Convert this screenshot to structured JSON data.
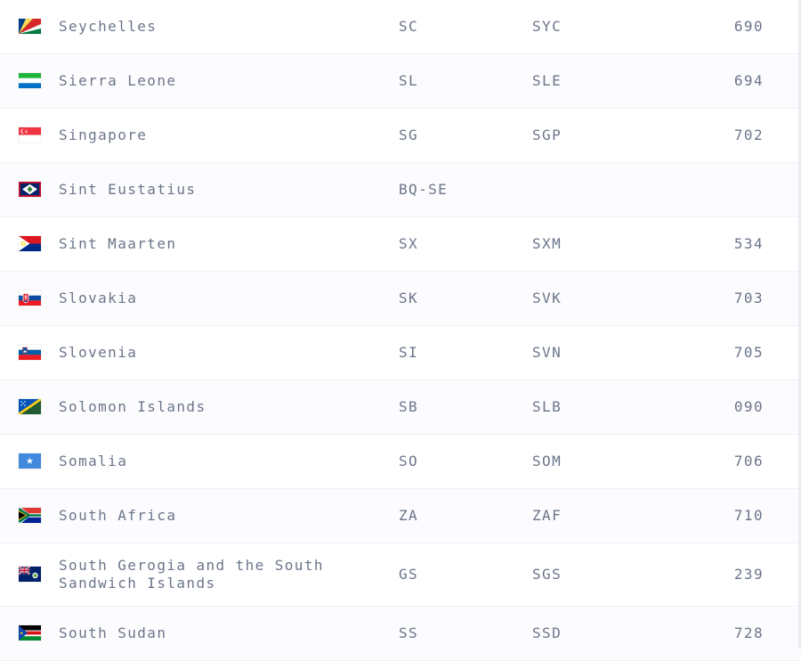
{
  "rows": [
    {
      "name": "Seychelles",
      "alpha2": "SC",
      "alpha3": "SYC",
      "numeric": "690",
      "flag": "seychelles-flag-icon"
    },
    {
      "name": "Sierra Leone",
      "alpha2": "SL",
      "alpha3": "SLE",
      "numeric": "694",
      "flag": "sierra-leone-flag-icon"
    },
    {
      "name": "Singapore",
      "alpha2": "SG",
      "alpha3": "SGP",
      "numeric": "702",
      "flag": "singapore-flag-icon"
    },
    {
      "name": "Sint Eustatius",
      "alpha2": "BQ-SE",
      "alpha3": "",
      "numeric": "",
      "flag": "sint-eustatius-flag-icon"
    },
    {
      "name": "Sint Maarten",
      "alpha2": "SX",
      "alpha3": "SXM",
      "numeric": "534",
      "flag": "sint-maarten-flag-icon"
    },
    {
      "name": "Slovakia",
      "alpha2": "SK",
      "alpha3": "SVK",
      "numeric": "703",
      "flag": "slovakia-flag-icon"
    },
    {
      "name": "Slovenia",
      "alpha2": "SI",
      "alpha3": "SVN",
      "numeric": "705",
      "flag": "slovenia-flag-icon"
    },
    {
      "name": "Solomon Islands",
      "alpha2": "SB",
      "alpha3": "SLB",
      "numeric": "090",
      "flag": "solomon-islands-flag-icon"
    },
    {
      "name": "Somalia",
      "alpha2": "SO",
      "alpha3": "SOM",
      "numeric": "706",
      "flag": "somalia-flag-icon"
    },
    {
      "name": "South Africa",
      "alpha2": "ZA",
      "alpha3": "ZAF",
      "numeric": "710",
      "flag": "south-africa-flag-icon"
    },
    {
      "name": "South Gerogia and the South Sandwich Islands",
      "alpha2": "GS",
      "alpha3": "SGS",
      "numeric": "239",
      "flag": "south-georgia-flag-icon"
    },
    {
      "name": "South Sudan",
      "alpha2": "SS",
      "alpha3": "SSD",
      "numeric": "728",
      "flag": "south-sudan-flag-icon"
    }
  ],
  "colors": {
    "text": "#6b7589",
    "row_bg": "#ffffff",
    "divider": "#eef0f4"
  }
}
